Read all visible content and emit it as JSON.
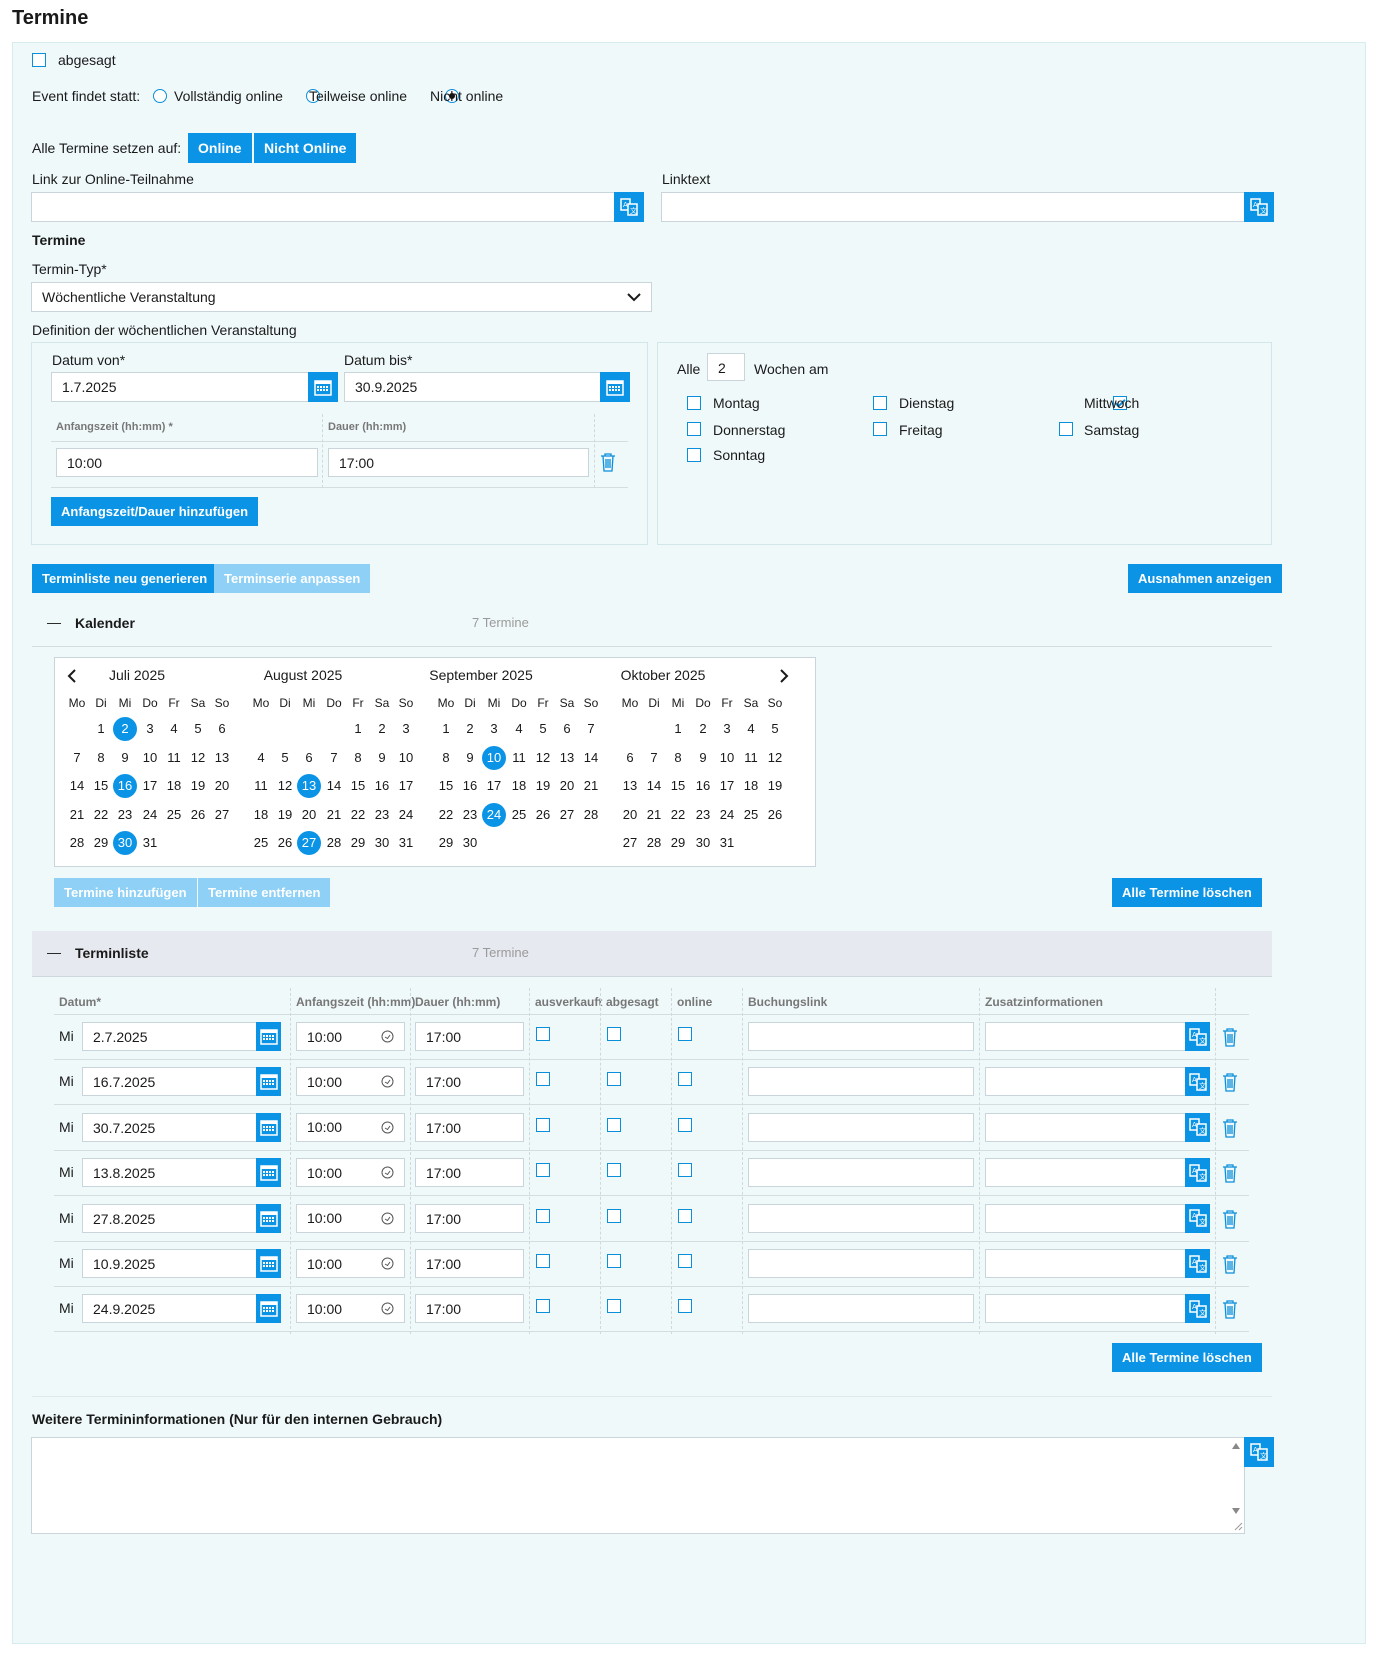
{
  "page_title": "Termine",
  "cancelled": {
    "label": "abgesagt",
    "checked": false
  },
  "event_location": {
    "label": "Event findet statt:",
    "options": [
      "Vollständig online",
      "Teilweise online",
      "Nicht online"
    ],
    "selected": "Nicht online"
  },
  "set_all": {
    "label": "Alle Termine setzen auf:",
    "btn_online": "Online",
    "btn_not_online": "Nicht Online"
  },
  "online_link": {
    "label": "Link zur Online-Teilnahme",
    "value": ""
  },
  "link_text": {
    "label": "Linktext",
    "value": ""
  },
  "termine_heading": "Termine",
  "termin_typ": {
    "label": "Termin-Typ*",
    "value": "Wöchentliche Veranstaltung"
  },
  "weekly_def": {
    "label": "Definition der wöchentlichen Veranstaltung",
    "date_from_label": "Datum von*",
    "date_from": "1.7.2025",
    "date_to_label": "Datum bis*",
    "date_to": "30.9.2025",
    "start_label": "Anfangszeit (hh:mm) *",
    "duration_label": "Dauer (hh:mm)",
    "start": "10:00",
    "duration": "17:00",
    "add_button": "Anfangszeit/Dauer hinzufügen"
  },
  "recurrence": {
    "every_label": "Alle",
    "every_value": "2",
    "weeks_label": "Wochen am",
    "days": [
      {
        "label": "Montag",
        "checked": false
      },
      {
        "label": "Dienstag",
        "checked": false
      },
      {
        "label": "Mittwoch",
        "checked": true
      },
      {
        "label": "Donnerstag",
        "checked": false
      },
      {
        "label": "Freitag",
        "checked": false
      },
      {
        "label": "Samstag",
        "checked": false
      },
      {
        "label": "Sonntag",
        "checked": false
      }
    ]
  },
  "actions": {
    "regenerate": "Terminliste neu generieren",
    "adjust": "Terminserie anpassen",
    "exceptions": "Ausnahmen anzeigen"
  },
  "calendar": {
    "toggle": "—",
    "title": "Kalender",
    "count": "7 Termine",
    "weekdays": [
      "Mo",
      "Di",
      "Mi",
      "Do",
      "Fr",
      "Sa",
      "So"
    ],
    "months": [
      {
        "name": "Juli 2025",
        "offset": 1,
        "days": 31,
        "selected": [
          2,
          16,
          30
        ]
      },
      {
        "name": "August 2025",
        "offset": 4,
        "days": 31,
        "selected": [
          13,
          27
        ]
      },
      {
        "name": "September 2025",
        "offset": 0,
        "days": 30,
        "selected": [
          10,
          24
        ]
      },
      {
        "name": "Oktober 2025",
        "offset": 2,
        "days": 31,
        "selected": []
      }
    ],
    "add_btn": "Termine hinzufügen",
    "remove_btn": "Termine entfernen",
    "delete_all_btn": "Alle Termine löschen"
  },
  "list": {
    "toggle": "—",
    "title": "Terminliste",
    "count": "7 Termine",
    "headers": [
      "Datum*",
      "Anfangszeit (hh:mm)",
      "Dauer (hh:mm)",
      "ausverkauft",
      "abgesagt",
      "online",
      "Buchungslink",
      "Zusatzinformationen"
    ],
    "rows": [
      {
        "day": "Mi",
        "date": "2.7.2025",
        "start": "10:00",
        "duration": "17:00"
      },
      {
        "day": "Mi",
        "date": "16.7.2025",
        "start": "10:00",
        "duration": "17:00"
      },
      {
        "day": "Mi",
        "date": "30.7.2025",
        "start": "10:00",
        "duration": "17:00"
      },
      {
        "day": "Mi",
        "date": "13.8.2025",
        "start": "10:00",
        "duration": "17:00"
      },
      {
        "day": "Mi",
        "date": "27.8.2025",
        "start": "10:00",
        "duration": "17:00"
      },
      {
        "day": "Mi",
        "date": "10.9.2025",
        "start": "10:00",
        "duration": "17:00"
      },
      {
        "day": "Mi",
        "date": "24.9.2025",
        "start": "10:00",
        "duration": "17:00"
      }
    ],
    "delete_all_btn": "Alle Termine löschen"
  },
  "further_info": {
    "label": "Weitere Termininformationen (Nur für den internen Gebrauch)",
    "value": ""
  },
  "colors": {
    "accent": "#0b94e6",
    "accent_disabled": "#8ed0f6",
    "panel_bg": "#f0f9fa",
    "list_header_bg": "#e6e9ef"
  },
  "icons": [
    "translate-icon",
    "calendar-icon",
    "clock-icon",
    "trash-icon",
    "chevron-down-icon",
    "chevron-left-icon",
    "chevron-right-icon"
  ]
}
